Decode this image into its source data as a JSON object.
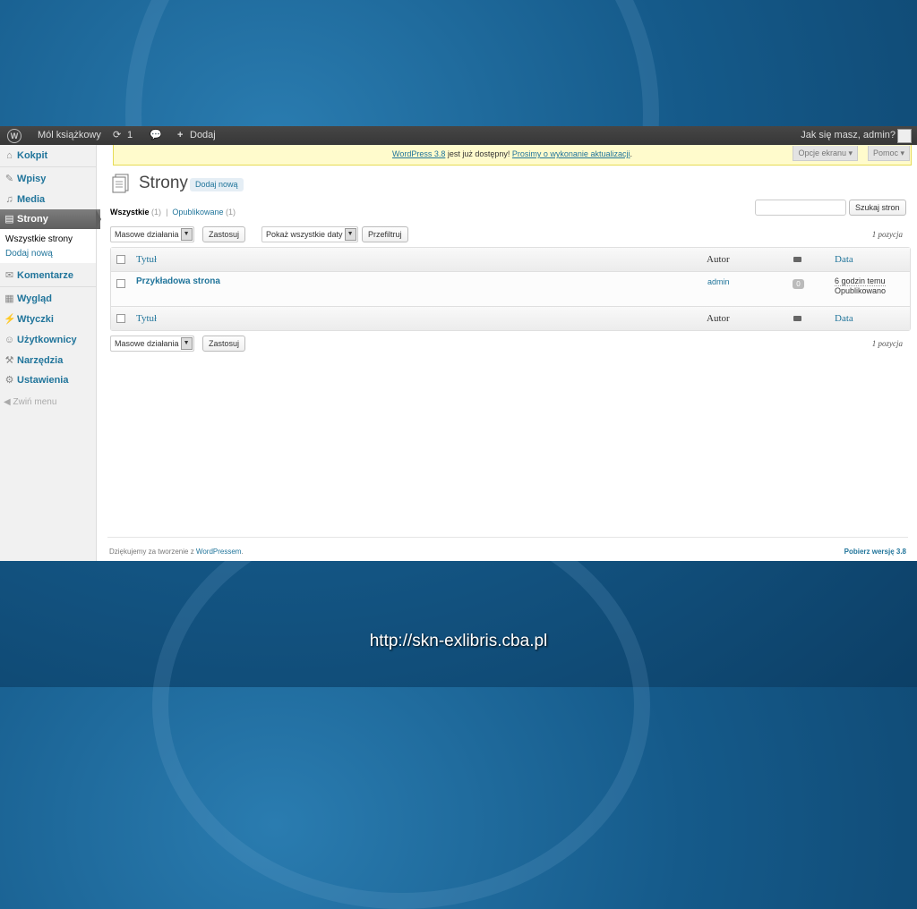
{
  "slide": {
    "url": "http://skn-exlibris.cba.pl"
  },
  "adminbar": {
    "logo_glyph": "W",
    "site_name": "Mól książkowy",
    "updates_count": "1",
    "new_label": "Dodaj",
    "greeting": "Jak się masz, admin?"
  },
  "sidebar": {
    "items": [
      {
        "label": "Kokpit",
        "icon": "home-icon",
        "glyph": "⌂"
      },
      {
        "label": "Wpisy",
        "icon": "pin-icon",
        "glyph": "✎"
      },
      {
        "label": "Media",
        "icon": "media-icon",
        "glyph": "♫"
      },
      {
        "label": "Strony",
        "icon": "pages-icon",
        "glyph": "▤"
      },
      {
        "label": "Komentarze",
        "icon": "comments-icon",
        "glyph": "✉"
      },
      {
        "label": "Wygląd",
        "icon": "appearance-icon",
        "glyph": "▦"
      },
      {
        "label": "Wtyczki",
        "icon": "plugins-icon",
        "glyph": "⚡"
      },
      {
        "label": "Użytkownicy",
        "icon": "users-icon",
        "glyph": "☺"
      },
      {
        "label": "Narzędzia",
        "icon": "tools-icon",
        "glyph": "⚒"
      },
      {
        "label": "Ustawienia",
        "icon": "settings-icon",
        "glyph": "⚙"
      }
    ],
    "submenu": [
      "Wszystkie strony",
      "Dodaj nową"
    ],
    "collapse_label": "Zwiń menu"
  },
  "notice": {
    "version_link": "WordPress 3.8",
    "middle_text": " jest już dostępny! ",
    "update_link": "Prosimy o wykonanie aktualizacji",
    "end": "."
  },
  "screen_options": "Opcje ekranu ▾",
  "help": "Pomoc ▾",
  "page": {
    "title": "Strony",
    "add_new": "Dodaj nową",
    "filter_all": "Wszystkie",
    "filter_all_count": "(1)",
    "separator": "|",
    "filter_published": "Opublikowane",
    "filter_published_count": "(1)",
    "search_button": "Szukaj stron"
  },
  "toolbar": {
    "bulk_select": "Masowe działania",
    "apply": "Zastosuj",
    "dates_select": "Pokaż wszystkie daty",
    "filter": "Przefiltruj",
    "count": "1 pozycja"
  },
  "table": {
    "columns": {
      "title": "Tytuł",
      "author": "Autor",
      "date": "Data"
    },
    "rows": [
      {
        "title": "Przykładowa strona",
        "author": "admin",
        "comments": "0",
        "date": "6 godzin temu",
        "status": "Opublikowano"
      }
    ]
  },
  "footer": {
    "thanks": "Dziękujemy za tworzenie z ",
    "wp_link": "WordPressem",
    "end": ".",
    "get_version": "Pobierz wersję 3.8"
  }
}
